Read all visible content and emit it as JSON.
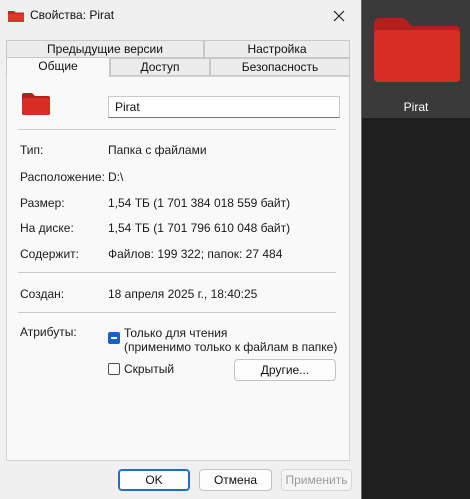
{
  "window": {
    "title": "Свойства: Pirat"
  },
  "tabs": {
    "top_row": [
      "Предыдущие версии",
      "Настройка"
    ],
    "bottom_row": [
      "Общие",
      "Доступ",
      "Безопасность"
    ],
    "active": "Общие"
  },
  "general": {
    "name_value": "Pirat",
    "type_label": "Тип:",
    "type_value": "Папка с файлами",
    "location_label": "Расположение:",
    "location_value": "D:\\",
    "size_label": "Размер:",
    "size_value": "1,54 ТБ (1 701 384 018 559 байт)",
    "disk_label": "На диске:",
    "disk_value": "1,54 ТБ (1 701 796 610 048 байт)",
    "contains_label": "Содержит:",
    "contains_value": "Файлов: 199 322; папок: 27 484",
    "created_label": "Создан:",
    "created_value": "18 апреля 2025 г., 18:40:25",
    "attributes_label": "Атрибуты:",
    "readonly_line1": "Только для чтения",
    "readonly_line2": "(применимо только к файлам в папке)",
    "readonly_state": "indeterminate",
    "hidden_label": "Скрытый",
    "hidden_checked": false,
    "other_button": "Другие..."
  },
  "footer": {
    "ok": "OK",
    "cancel": "Отмена",
    "apply": "Применить"
  },
  "desktop": {
    "folder_label": "Pirat"
  },
  "colors": {
    "folder_red": "#d02a24",
    "accent_blue": "#1565c0"
  },
  "icons": [
    "folder-icon",
    "close-icon"
  ]
}
